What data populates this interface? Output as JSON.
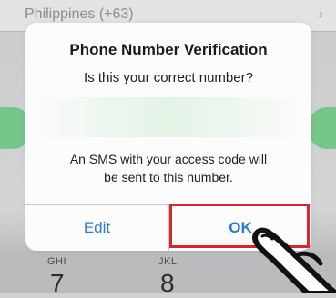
{
  "background": {
    "country_label": "Philippines (+63)",
    "keypad": [
      {
        "letters": "GHI",
        "digit": "7"
      },
      {
        "letters": "JKL",
        "digit": "8"
      }
    ]
  },
  "dialog": {
    "title": "Phone Number Verification",
    "subtitle": "Is this your correct number?",
    "message_line1": "An SMS with your access code will",
    "message_line2": "be sent to this number.",
    "buttons": {
      "edit": "Edit",
      "ok": "OK"
    }
  },
  "colors": {
    "button_text": "#2f7bd4",
    "highlight": "#d9262c",
    "accent_green": "#76c58a"
  },
  "icons": {
    "chevron": "chevron-right-icon",
    "pointer": "pointing-hand-icon"
  }
}
